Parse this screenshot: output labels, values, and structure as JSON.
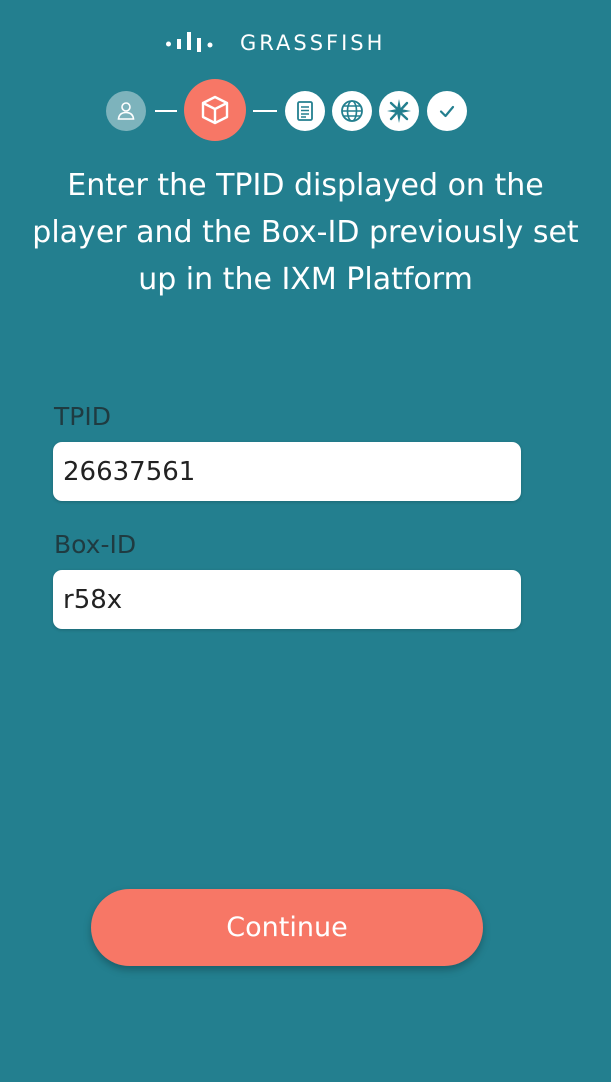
{
  "brand": {
    "name": "GRASSFISH",
    "logo_icon": "grassfish-bars-icon"
  },
  "steps": [
    {
      "icon": "user-icon",
      "state": "done"
    },
    {
      "icon": "box-icon",
      "state": "active"
    },
    {
      "icon": "document-icon",
      "state": "todo"
    },
    {
      "icon": "globe-icon",
      "state": "todo"
    },
    {
      "icon": "compass-star-icon",
      "state": "todo"
    },
    {
      "icon": "check-icon",
      "state": "todo"
    }
  ],
  "headline": "Enter the TPID displayed on the player and the Box-ID previously set up in the IXM Platform",
  "form": {
    "tpid_label": "TPID",
    "tpid_value": "26637561",
    "boxid_label": "Box-ID",
    "boxid_value": "r58x"
  },
  "continue_label": "Continue",
  "colors": {
    "background": "#237f8f",
    "accent": "#f77766",
    "done_step": "#7db3bc",
    "label_text": "#1f3b41"
  }
}
